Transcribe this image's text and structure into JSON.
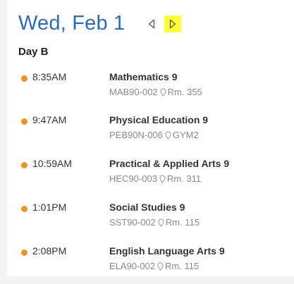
{
  "header": {
    "date": "Wed, Feb 1"
  },
  "day_label": "Day B",
  "colors": {
    "accent": "#2a6bbf",
    "dot": "#f0931c",
    "highlight": "#ffff33"
  },
  "periods": [
    {
      "time": "8:35AM",
      "course": "Mathematics 9",
      "section": "MAB90-002",
      "room": "Rm. 355"
    },
    {
      "time": "9:47AM",
      "course": "Physical Education 9",
      "section": "PEB90N-006",
      "room": "GYM2"
    },
    {
      "time": "10:59AM",
      "course": "Practical & Applied Arts 9",
      "section": "HEC90-003",
      "room": "Rm. 311"
    },
    {
      "time": "1:01PM",
      "course": "Social Studies 9",
      "section": "SST90-002",
      "room": "Rm. 115"
    },
    {
      "time": "2:08PM",
      "course": "English Language Arts 9",
      "section": "ELA90-002",
      "room": "Rm. 115"
    }
  ]
}
